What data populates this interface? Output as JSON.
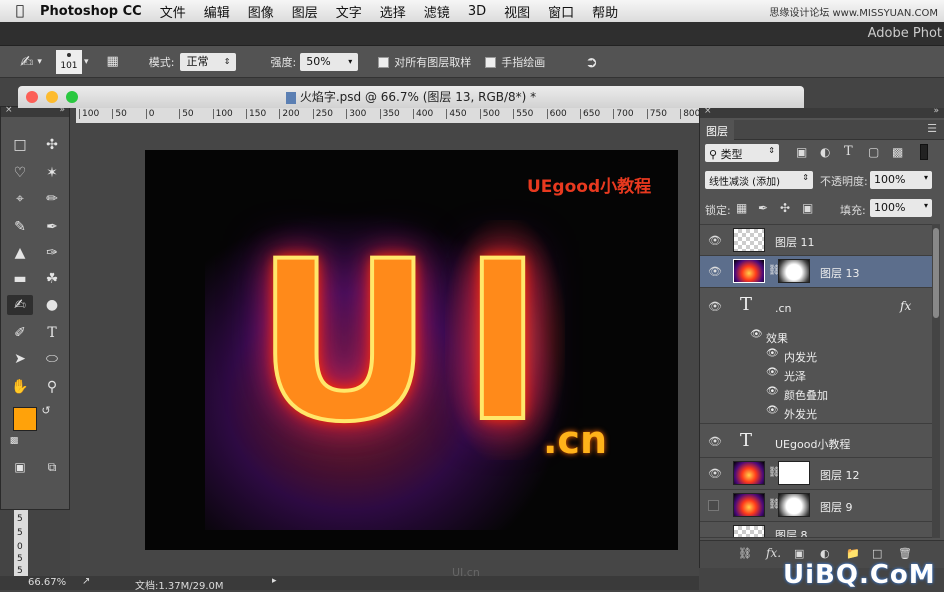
{
  "menubar": {
    "app": "Photoshop CC",
    "items": [
      "文件",
      "编辑",
      "图像",
      "图层",
      "文字",
      "选择",
      "滤镜",
      "3D",
      "视图",
      "窗口",
      "帮助"
    ],
    "watermark": "思缘设计论坛 www.MISSYUAN.COM"
  },
  "app_title": "Adobe Phot",
  "options": {
    "brush_size": "101",
    "mode_label": "模式:",
    "mode_value": "正常",
    "strength_label": "强度:",
    "strength_value": "50%",
    "sample_all_label": "对所有图层取样",
    "finger_paint_label": "手指绘画"
  },
  "document": {
    "title": "火焰字.psd @ 66.7% (图层 13, RGB/8*) *",
    "ruler_ticks": [
      "100",
      "50",
      "0",
      "50",
      "100",
      "150",
      "200",
      "250",
      "300",
      "350",
      "400",
      "450",
      "500",
      "550",
      "600",
      "650",
      "700",
      "750",
      "800"
    ],
    "vruler_ticks": [
      "5",
      "5",
      "0",
      "5",
      "5"
    ],
    "artwork_brand": "UEgood小教程",
    "artwork_letters": "UI",
    "artwork_suffix": ".cn"
  },
  "status": {
    "zoom": "66.67%",
    "doc_size": "文档:1.37M/29.0M"
  },
  "layers_panel": {
    "title": "图层",
    "filter_kind": "类型",
    "blend_mode": "线性减淡 (添加)",
    "opacity_label": "不透明度:",
    "opacity_value": "100%",
    "lock_label": "锁定:",
    "fill_label": "填充:",
    "fill_value": "100%",
    "layers": [
      {
        "name": "图层 11"
      },
      {
        "name": "图层 13"
      },
      {
        "name": ".cn",
        "fx": "fx"
      },
      {
        "name": "UEgood小教程"
      },
      {
        "name": "图层 12"
      },
      {
        "name": "图层 9"
      },
      {
        "name": "图层 8"
      }
    ],
    "effects_label": "效果",
    "effects": [
      "内发光",
      "光泽",
      "颜色叠加",
      "外发光"
    ]
  },
  "footer": {
    "center_logo": "UI.cn",
    "corner_watermark": "UiBQ.CoM"
  },
  "colors": {
    "foreground": "#ffa20a",
    "background": "#ffffff",
    "brand_red": "#e8391f",
    "selected_layer": "#5c6e8c"
  }
}
